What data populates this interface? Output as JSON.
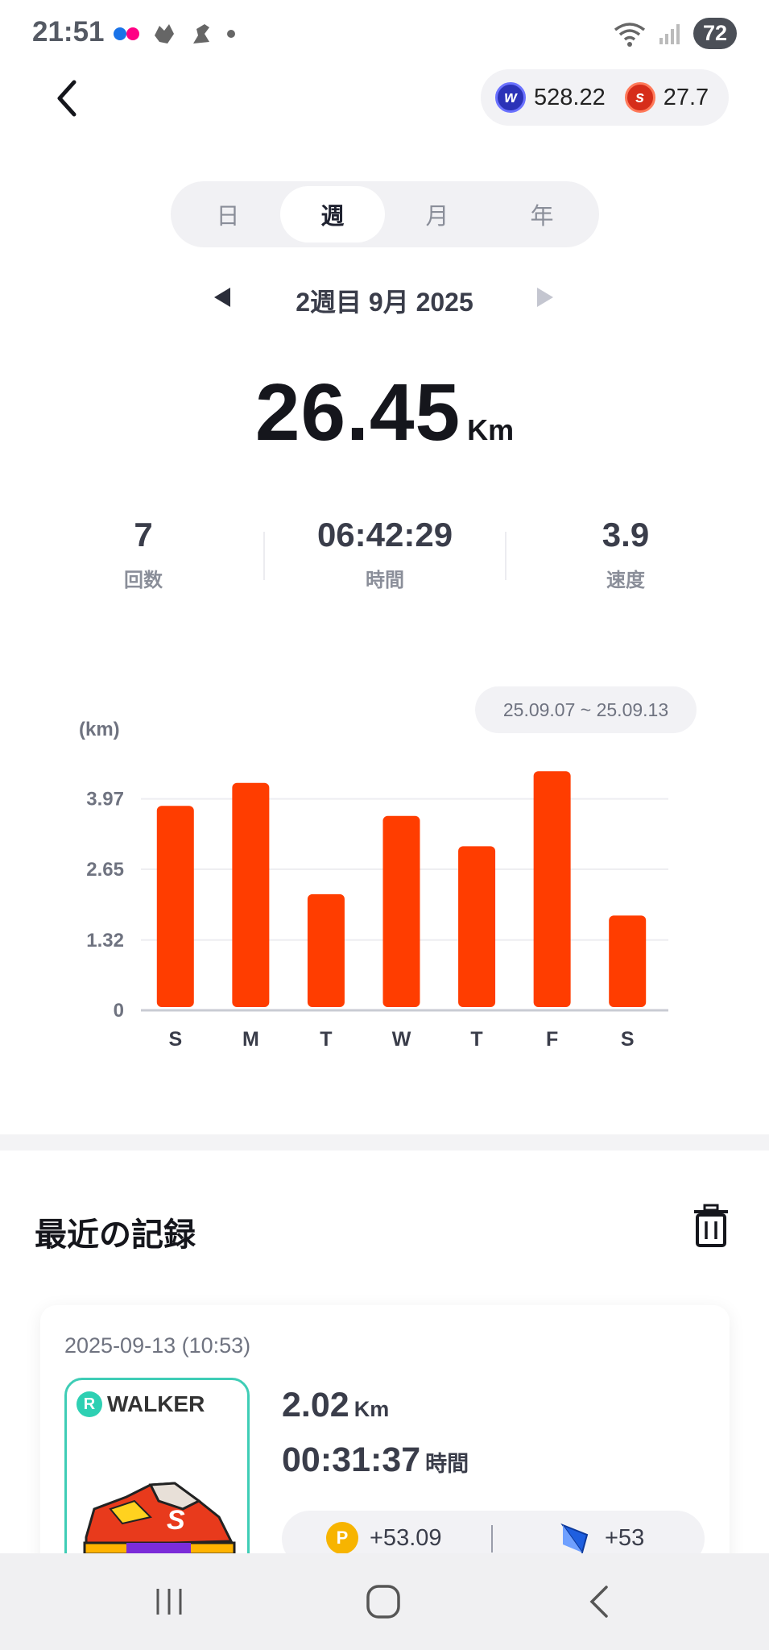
{
  "status_bar": {
    "time": "21:51",
    "battery": "72"
  },
  "header": {
    "currency_w": {
      "icon": "w-coin-icon",
      "value": "528.22",
      "color": "#2b32b8"
    },
    "currency_s": {
      "icon": "s-coin-icon",
      "value": "27.7",
      "color": "#d62d1a"
    }
  },
  "tabs": [
    {
      "label": "日",
      "active": false
    },
    {
      "label": "週",
      "active": true
    },
    {
      "label": "月",
      "active": false
    },
    {
      "label": "年",
      "active": false
    }
  ],
  "period": {
    "label": "2週目 9月 2025"
  },
  "summary": {
    "distance": "26.45",
    "unit": "Km"
  },
  "stats": [
    {
      "value": "7",
      "label": "回数"
    },
    {
      "value": "06:42:29",
      "label": "時間"
    },
    {
      "value": "3.9",
      "label": "速度"
    }
  ],
  "chart_range": "25.09.07 ~ 25.09.13",
  "chart_data": {
    "type": "bar",
    "categories": [
      "S",
      "M",
      "T",
      "W",
      "T",
      "F",
      "S"
    ],
    "values": [
      3.78,
      4.21,
      2.12,
      3.59,
      3.02,
      4.43,
      1.72
    ],
    "ylabel": "(km)",
    "yticks": [
      "0",
      "1.32",
      "2.65",
      "3.97"
    ],
    "ytick_values": [
      0,
      1.32,
      2.65,
      3.97
    ],
    "ylim": [
      0,
      4.6
    ],
    "bar_color": "#ff3d00",
    "grid": true
  },
  "recent": {
    "title": "最近の記録",
    "records": [
      {
        "date": "2025-09-13 (10:53)",
        "shoe_badge": "R",
        "shoe_label": "WALKER",
        "distance": "2.02",
        "distance_unit": "Km",
        "time": "00:31:37",
        "time_unit": "時間",
        "reward_points": "+53.09",
        "reward_gems": "+53"
      }
    ]
  }
}
